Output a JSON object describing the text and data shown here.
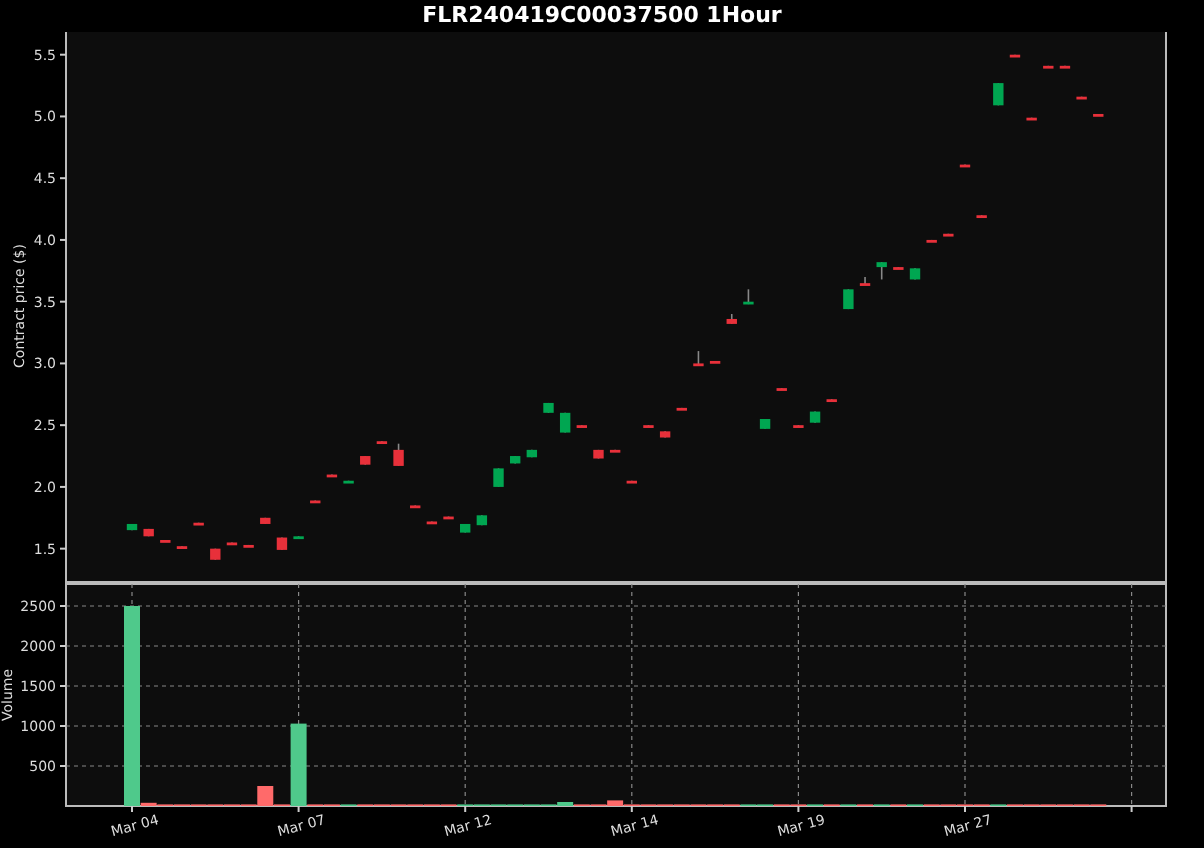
{
  "title": "FLR240419C00037500 1Hour",
  "price_chart": {
    "ylabel": "Contract price ($)",
    "yticks": [
      "5.5",
      "5.0",
      "4.5",
      "4.0",
      "3.5",
      "3.0",
      "2.5",
      "2.0",
      "1.5"
    ]
  },
  "volume_chart": {
    "chart_data": {
      "type": "bar",
      "ylabel": "Volume",
      "ylim": [
        0,
        2775
      ],
      "grid": true,
      "yticks": [
        500,
        1000,
        1500,
        2000,
        2500
      ],
      "categories": [
        "Mar 04",
        null,
        null,
        null,
        null,
        null,
        null,
        null,
        null,
        null,
        "Mar 07",
        null,
        null,
        null,
        null,
        null,
        null,
        null,
        null,
        null,
        "Mar 12",
        null,
        null,
        null,
        null,
        null,
        null,
        null,
        null,
        null,
        "Mar 14",
        null,
        null,
        null,
        null,
        null,
        null,
        null,
        null,
        null,
        "Mar 19",
        null,
        null,
        null,
        null,
        null,
        null,
        null,
        null,
        null,
        "Mar 27",
        null,
        null,
        null,
        null,
        null,
        null,
        null,
        null
      ],
      "series": [
        {
          "values": [
            2500,
            40,
            20,
            20,
            20,
            20,
            20,
            20,
            250,
            20,
            1030,
            20,
            20,
            20,
            20,
            20,
            20,
            20,
            20,
            20,
            20,
            20,
            20,
            20,
            20,
            20,
            50,
            20,
            20,
            70,
            20,
            20,
            20,
            20,
            20,
            20,
            20,
            20,
            20,
            20,
            20,
            20,
            20,
            20,
            20,
            20,
            20,
            20,
            20,
            20,
            20,
            20,
            20,
            20,
            20,
            20,
            20,
            20,
            20
          ]
        }
      ]
    }
  }
}
